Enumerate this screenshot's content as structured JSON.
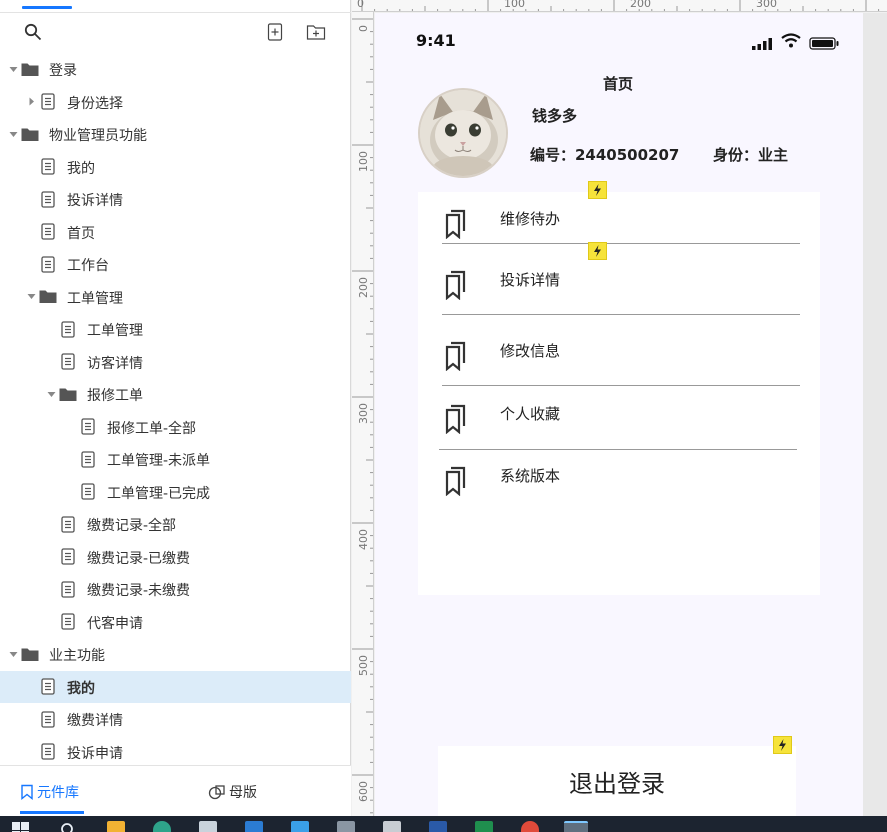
{
  "left_panel": {
    "tree": [
      {
        "label": "登录",
        "type": "folder",
        "level": 0,
        "caret": "open"
      },
      {
        "label": "身份选择",
        "type": "page",
        "level": 1,
        "caret": "closed"
      },
      {
        "label": "物业管理员功能",
        "type": "folder",
        "level": 0,
        "caret": "open"
      },
      {
        "label": "我的",
        "type": "page",
        "level": 1,
        "caret": "none"
      },
      {
        "label": "投诉详情",
        "type": "page",
        "level": 1,
        "caret": "none"
      },
      {
        "label": "首页",
        "type": "page",
        "level": 1,
        "caret": "none"
      },
      {
        "label": "工作台",
        "type": "page",
        "level": 1,
        "caret": "none"
      },
      {
        "label": "工单管理",
        "type": "folder",
        "level": 1,
        "caret": "open"
      },
      {
        "label": "工单管理",
        "type": "page",
        "level": 2,
        "caret": "none"
      },
      {
        "label": "访客详情",
        "type": "page",
        "level": 2,
        "caret": "none"
      },
      {
        "label": "报修工单",
        "type": "folder",
        "level": 2,
        "caret": "open"
      },
      {
        "label": "报修工单-全部",
        "type": "page",
        "level": 3,
        "caret": "none"
      },
      {
        "label": "工单管理-未派单",
        "type": "page",
        "level": 3,
        "caret": "none"
      },
      {
        "label": "工单管理-已完成",
        "type": "page",
        "level": 3,
        "caret": "none"
      },
      {
        "label": "缴费记录-全部",
        "type": "page",
        "level": 2,
        "caret": "none"
      },
      {
        "label": "缴费记录-已缴费",
        "type": "page",
        "level": 2,
        "caret": "none"
      },
      {
        "label": "缴费记录-未缴费",
        "type": "page",
        "level": 2,
        "caret": "none"
      },
      {
        "label": "代客申请",
        "type": "page",
        "level": 2,
        "caret": "none"
      },
      {
        "label": "业主功能",
        "type": "folder",
        "level": 0,
        "caret": "open"
      },
      {
        "label": "我的",
        "type": "page",
        "level": 1,
        "caret": "none",
        "active": true
      },
      {
        "label": "缴费详情",
        "type": "page",
        "level": 1,
        "caret": "none"
      },
      {
        "label": "投诉申请",
        "type": "page",
        "level": 1,
        "caret": "none"
      }
    ],
    "bottom_tabs": {
      "library": "元件库",
      "masters": "母版"
    }
  },
  "rulers": {
    "top": [
      "0",
      "100",
      "200",
      "300"
    ],
    "left": [
      "0",
      "100",
      "200",
      "300",
      "400",
      "500",
      "600"
    ]
  },
  "phone": {
    "status_time": "9:41",
    "page_title": "首页",
    "user_name": "钱多多",
    "user_id": "编号：2440500207",
    "user_role": "身份：业主",
    "menu": [
      "维修待办",
      "投诉详情",
      "修改信息",
      "个人收藏",
      "系统版本"
    ],
    "logout": "退出登录"
  },
  "colors": {
    "accent": "#1677ff",
    "active_row": "#dcecf9",
    "canvas_bg": "#f9f7ff",
    "interaction_marker": "#f6e33a"
  }
}
